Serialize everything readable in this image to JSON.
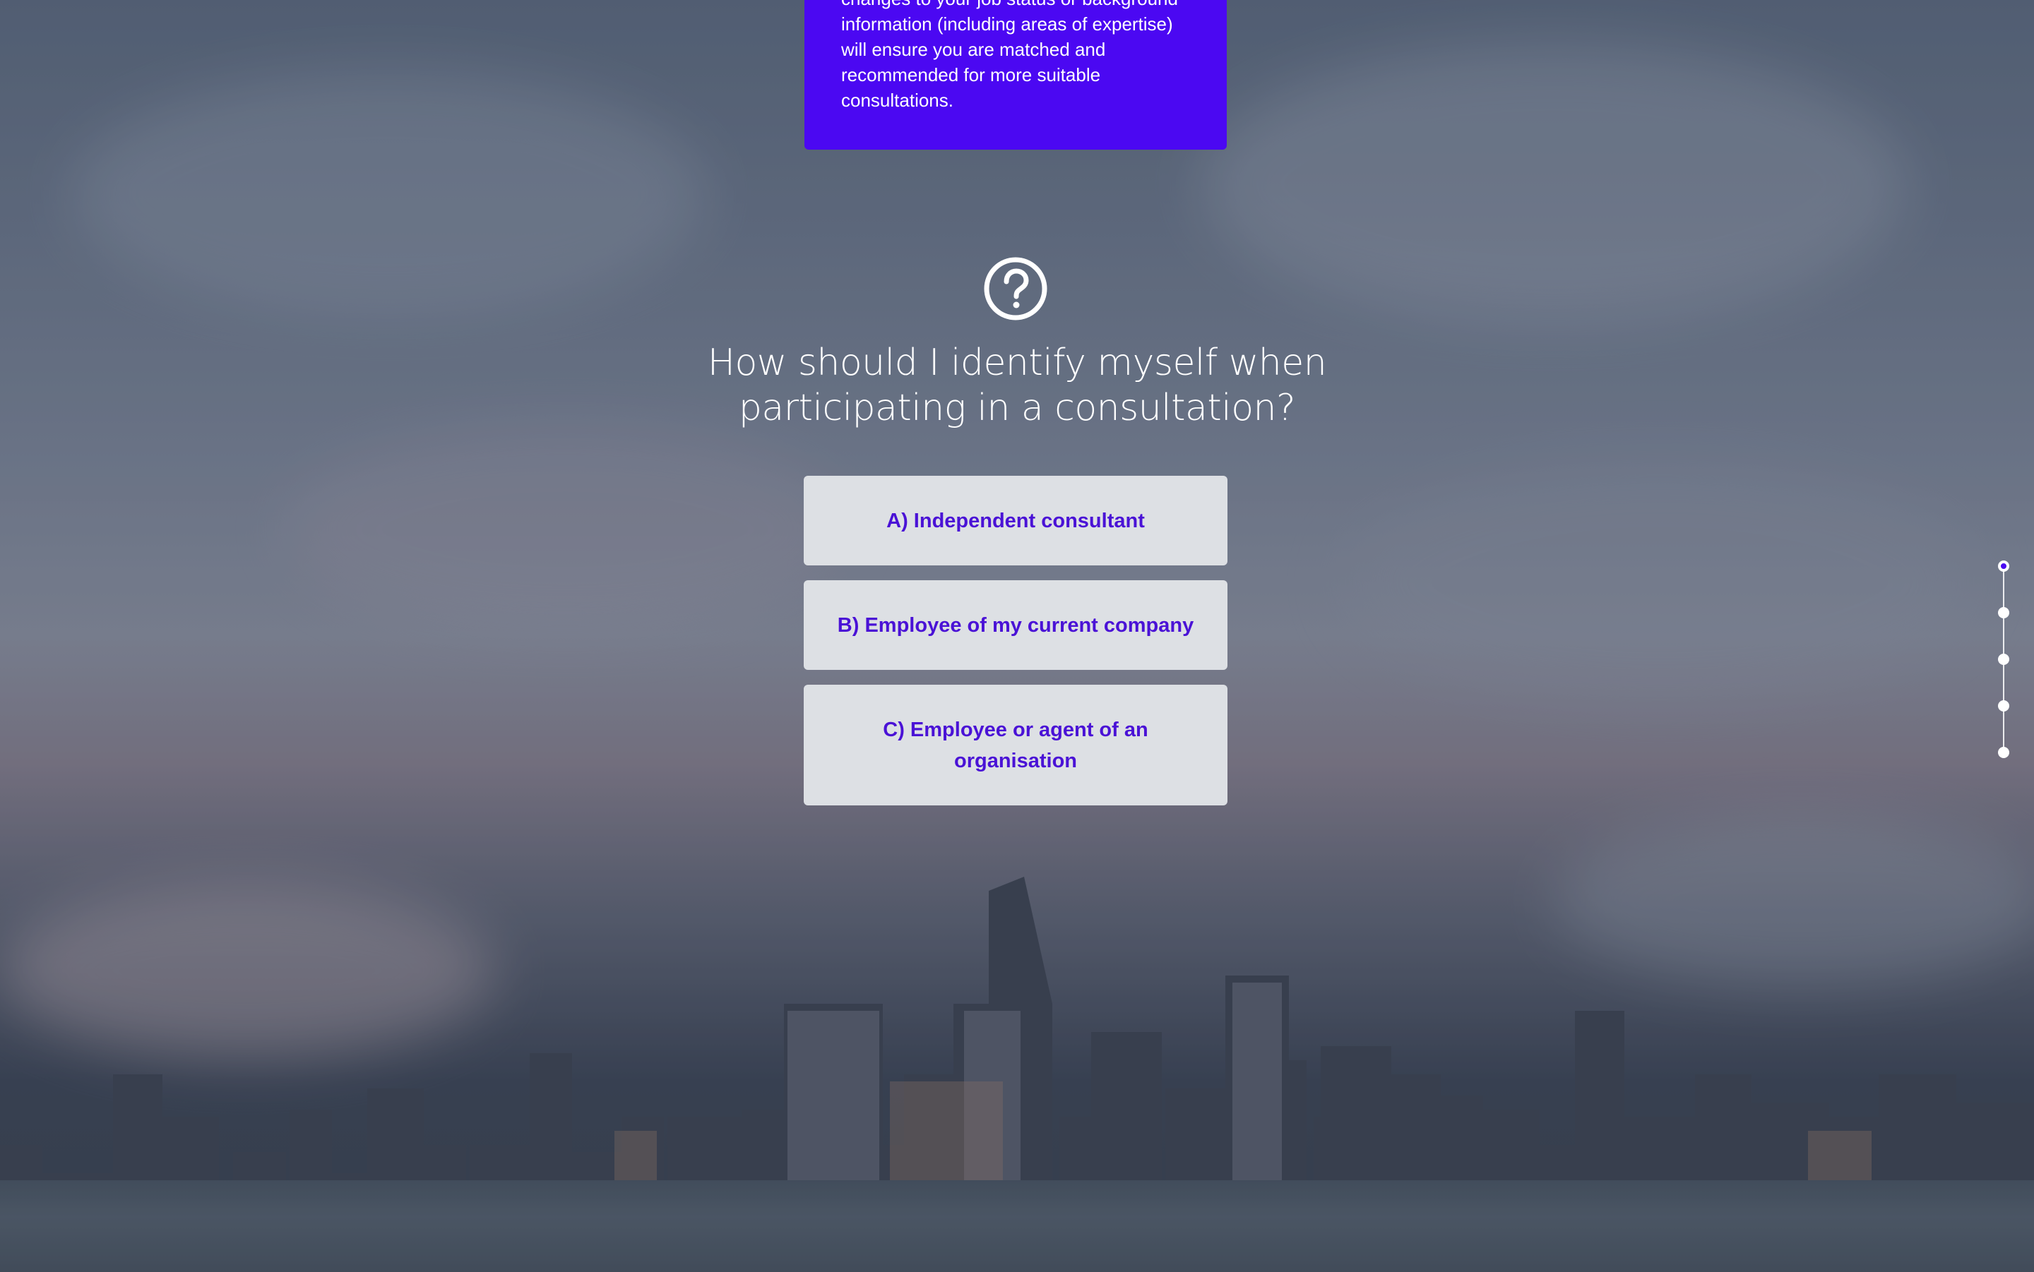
{
  "info_card": {
    "text": "changes to your job status or background information (including areas of expertise) will ensure you are matched and recommended for more suitable consultations."
  },
  "question": {
    "icon": "question-circle-icon",
    "title": "How should I identify myself when participating in a consultation?"
  },
  "answers": [
    {
      "label": "A) Independent consultant"
    },
    {
      "label": "B) Employee of my current company"
    },
    {
      "label": "C) Employee or agent of an organisation"
    }
  ],
  "progress": {
    "steps": 5,
    "current": 1
  },
  "colors": {
    "accent": "#4b08f2",
    "answer_bg": "#dde0e4",
    "answer_text": "#4a12d6"
  }
}
